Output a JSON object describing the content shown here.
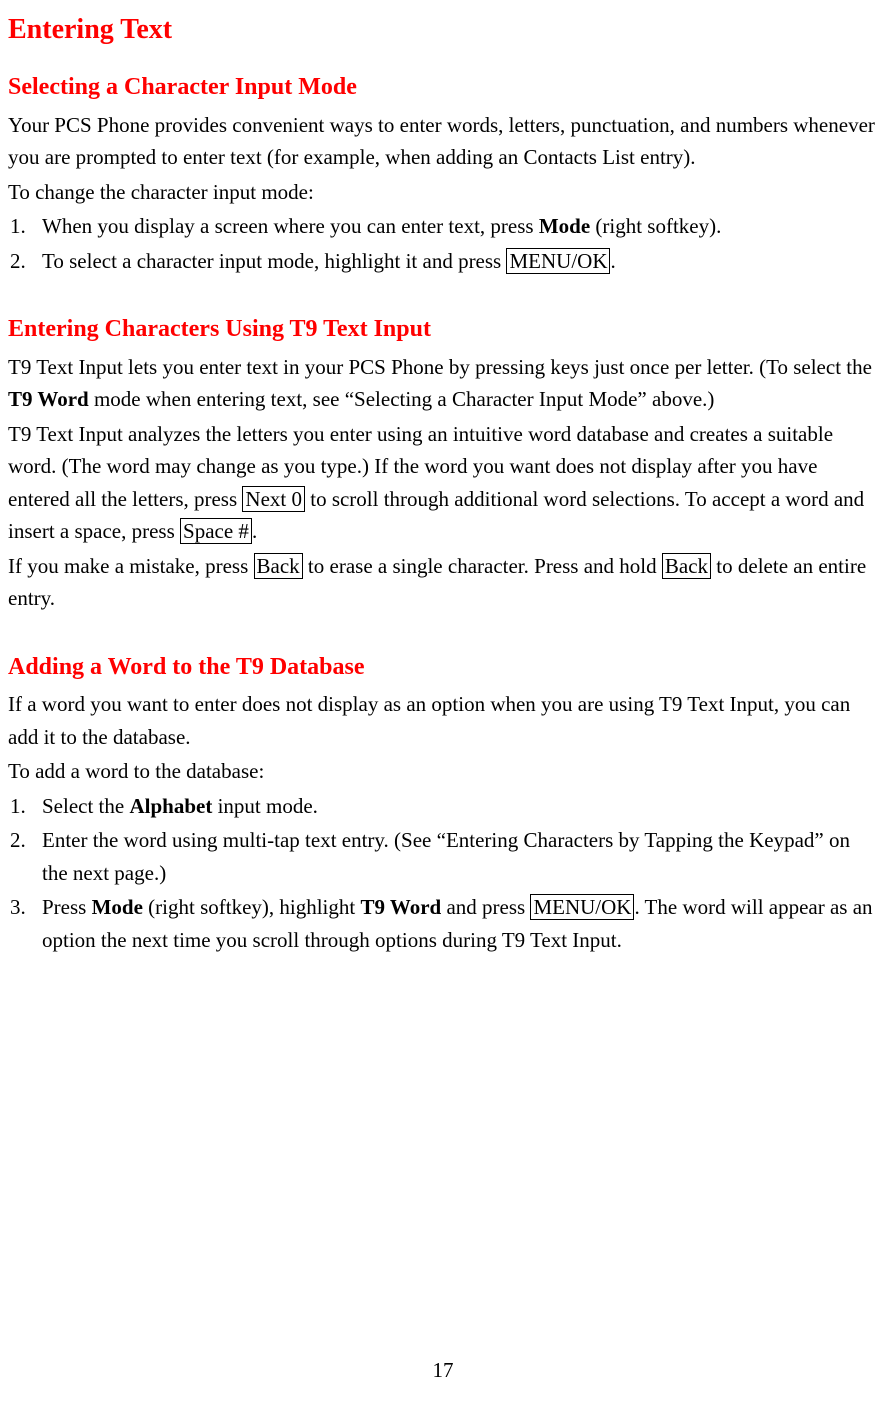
{
  "title": "Entering Text",
  "sections": [
    {
      "heading": "Selecting a Character Input Mode",
      "intro1": "Your PCS Phone provides convenient ways to enter words, letters, punctuation, and numbers whenever you are prompted to enter text (for example, when adding an Contacts List entry).",
      "intro2": "To change the character input mode:",
      "list": [
        {
          "n": "1.",
          "pre": "When you display a screen where you can enter text, press ",
          "bold": "Mode",
          "post": " (right softkey)."
        },
        {
          "n": "2.",
          "pre": "To select a character input mode, highlight it and press ",
          "box": "MENU/OK",
          "post": "."
        }
      ]
    },
    {
      "heading": "Entering Characters Using T9 Text Input",
      "p1_a": "T9 Text Input lets you enter text in your PCS Phone by pressing keys just once per letter. (To select the ",
      "p1_b": "T9 Word",
      "p1_c": " mode when entering text, see “Selecting a Character Input Mode” above.)",
      "p2_a": "T9 Text Input analyzes the letters you enter using an intuitive word database and creates a suitable word. (The word may change as you type.) If the word you want does not display after you have entered all the letters, press ",
      "p2_b": "Next 0",
      "p2_c": " to scroll through additional word selections. To accept a word and insert a space, press ",
      "p2_d": "Space #",
      "p2_e": ".",
      "p3_a": "If you make a mistake, press ",
      "p3_b": "Back",
      "p3_c": " to erase a single character. Press and hold ",
      "p3_d": "Back",
      "p3_e": " to delete an entire entry."
    },
    {
      "heading": "Adding a Word to the T9 Database",
      "intro1": "If a word you want to enter does not display as an option when you are using T9 Text Input, you can add it to the database.",
      "intro2": "To add a word to the database:",
      "li1": {
        "n": "1.",
        "a": "Select the ",
        "b": "Alphabet",
        "c": " input mode."
      },
      "li2": {
        "n": "2.",
        "a": "Enter the word using multi-tap text entry. (See “Entering Characters by Tapping the Keypad” on the next page.)"
      },
      "li3": {
        "n": "3.",
        "a": "Press ",
        "b": "Mode",
        "c": " (right softkey), highlight ",
        "d": "T9 Word",
        "e": " and press ",
        "f": "MENU/OK",
        "g": ". The word will appear as an option the next time you scroll through options during T9 Text Input."
      }
    }
  ],
  "page_number": "17"
}
